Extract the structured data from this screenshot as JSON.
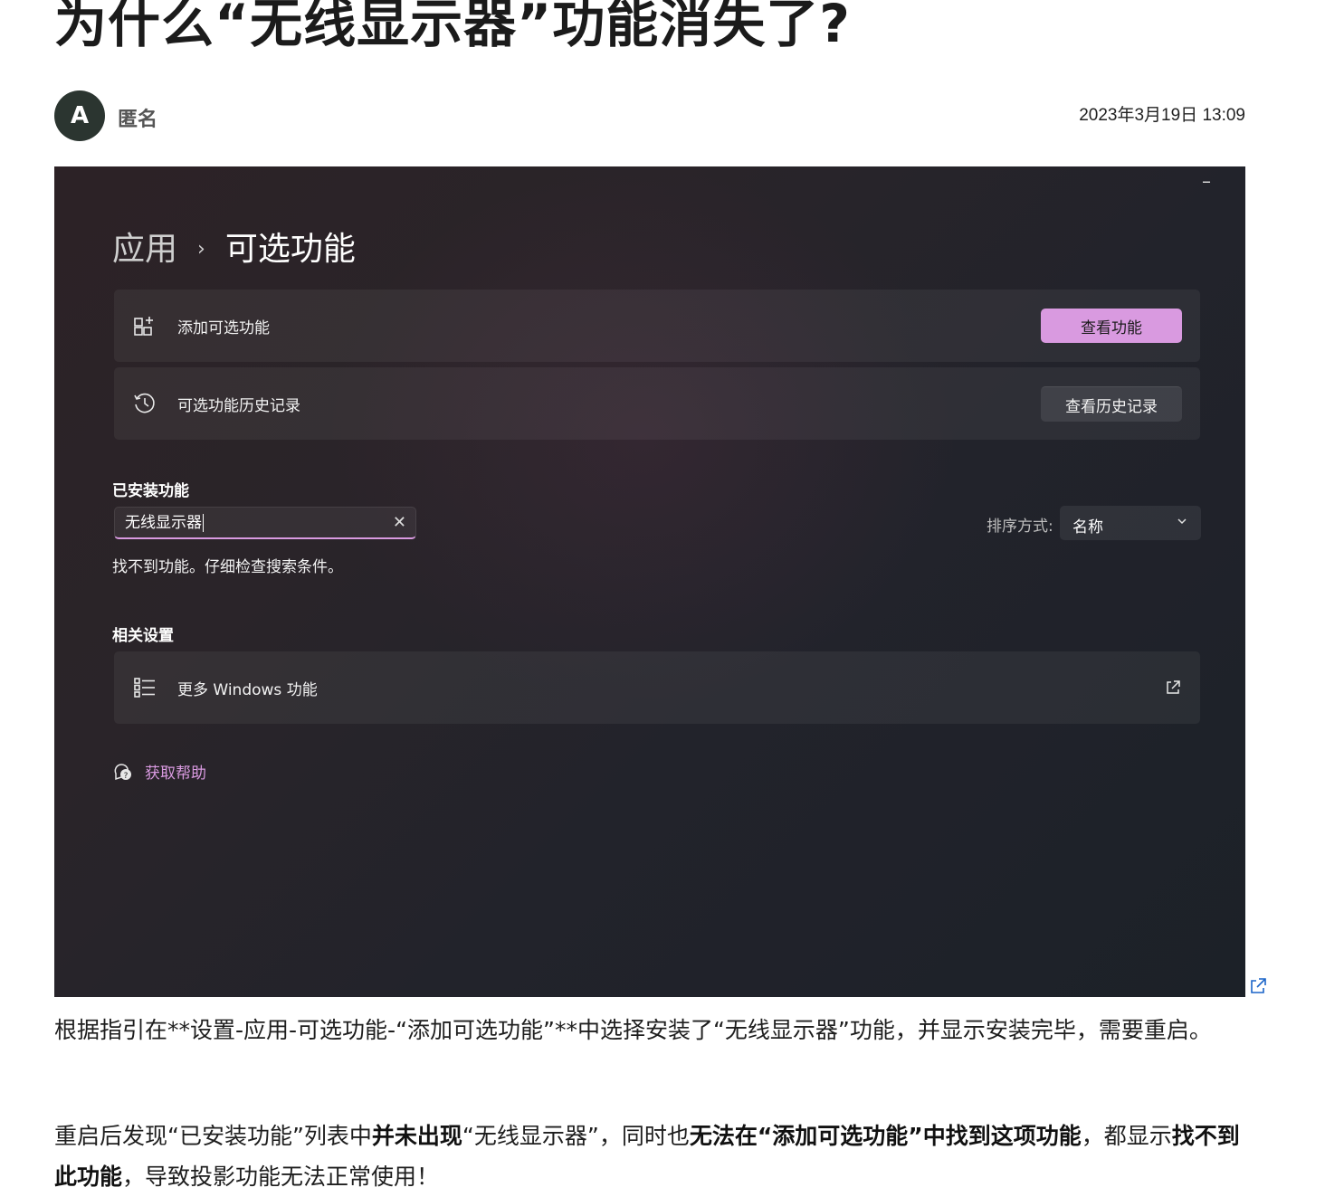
{
  "post": {
    "title": "为什么“无线显示器”功能消失了?",
    "author_initial": "A",
    "author": "匿名",
    "date": "2023年3月19日 13:09"
  },
  "screenshot": {
    "minimize": "–",
    "breadcrumb": {
      "root": "应用",
      "separator": "›",
      "current": "可选功能"
    },
    "add_card": {
      "label": "添加可选功能",
      "button": "查看功能",
      "icon": "add-feature-icon"
    },
    "history_card": {
      "label": "可选功能历史记录",
      "button": "查看历史记录",
      "icon": "history-icon"
    },
    "installed": {
      "heading": "已安装功能",
      "search_value": "无线显示器",
      "clear": "✕",
      "sort_label": "排序方式:",
      "sort_value": "名称",
      "empty_message": "找不到功能。仔细检查搜索条件。"
    },
    "related": {
      "heading": "相关设置",
      "more_windows": "更多 Windows 功能",
      "icon": "list-icon"
    },
    "help": {
      "label": "获取帮助",
      "icon": "help-chat-icon"
    },
    "accent_color": "#d99ae0"
  },
  "body": {
    "p1": {
      "s1": "根据指引在**设置-应用-可选功能-“添加可选功能”**中选择安装了“无线显示器”功能，并显示安装完毕，需要重启。"
    },
    "p2": {
      "s1": "重启后发现“已安装功能”列表中",
      "b1": "并未出现",
      "s2": "“无线显示器”，同时也",
      "b2": "无法在“添加可选功能”中找到这项功能",
      "s3": "，都显示",
      "b3": "找不到此功能",
      "s4": "，导致投影功能无法正常使用！"
    }
  }
}
